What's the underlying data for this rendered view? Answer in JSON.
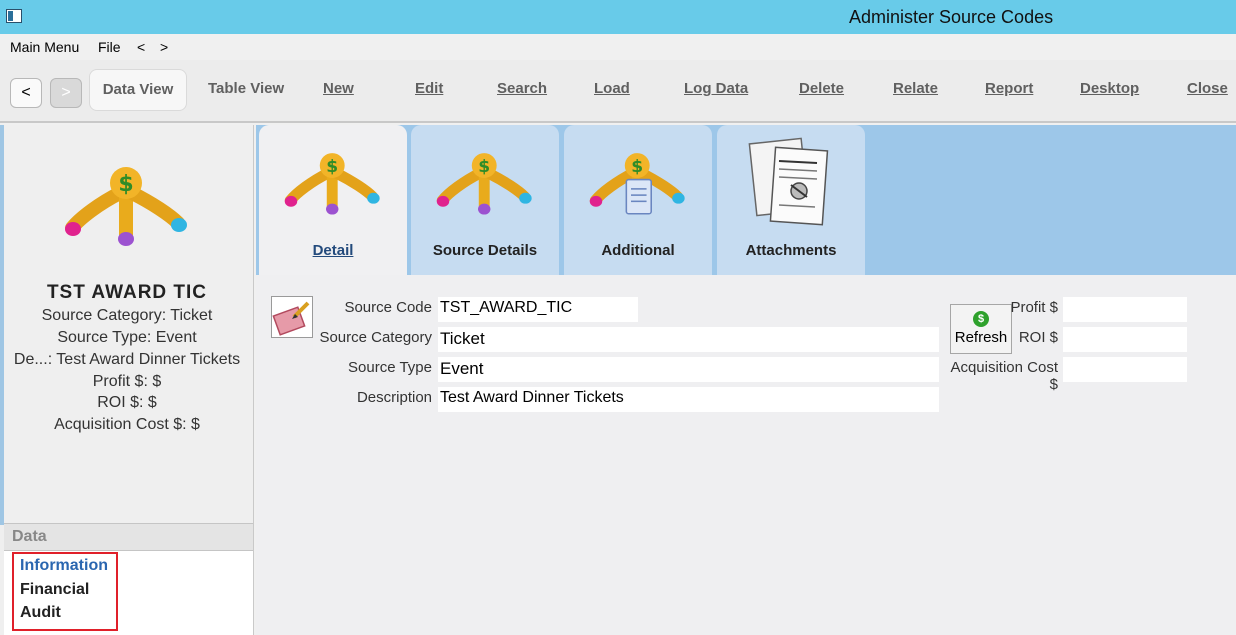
{
  "window": {
    "title": "Administer Source Codes"
  },
  "menu": {
    "items": [
      "Main Menu",
      "File",
      "<",
      ">"
    ]
  },
  "toolbar": {
    "back_label": "<",
    "forward_label": ">",
    "data_view": "Data View",
    "table_view": "Table View",
    "new": "New",
    "edit": "Edit",
    "search": "Search",
    "load": "Load",
    "log_data": "Log Data",
    "delete": "Delete",
    "relate": "Relate",
    "report": "Report",
    "desktop": "Desktop",
    "close": "Close"
  },
  "record": {
    "name": "TST  AWARD  TIC",
    "lines": [
      "Source Category: Ticket",
      "Source Type: Event",
      "De...: Test Award Dinner Tickets",
      "Profit $: $",
      "ROI $: $",
      "Acquisition Cost $: $"
    ]
  },
  "data_panel": {
    "header": "Data",
    "items": [
      "Information",
      "Financial",
      "Audit"
    ],
    "selected": "Information"
  },
  "tabs": [
    {
      "label": "Detail",
      "icon": "source-code-icon"
    },
    {
      "label": "Source Details",
      "icon": "source-code-icon"
    },
    {
      "label": "Additional",
      "icon": "source-notes-icon"
    },
    {
      "label": "Attachments",
      "icon": "attachments-icon"
    }
  ],
  "form": {
    "source_code_label": "Source Code",
    "source_code": "TST_AWARD_TIC",
    "source_category_label": "Source Category",
    "source_category": "Ticket",
    "source_type_label": "Source Type",
    "source_type": "Event",
    "description_label": "Description",
    "description": "Test Award Dinner Tickets",
    "refresh_label": "Refresh",
    "profit_label": "Profit $",
    "profit": "",
    "roi_label": "ROI $",
    "roi": "",
    "acq_cost_label": "Acquisition Cost $",
    "acq_cost": ""
  },
  "colors": {
    "titlebar": "#68cbe9",
    "tabstrip": "#9dc7e9",
    "selected_item": "#2a66b0",
    "highlight_box": "#e0202a"
  }
}
